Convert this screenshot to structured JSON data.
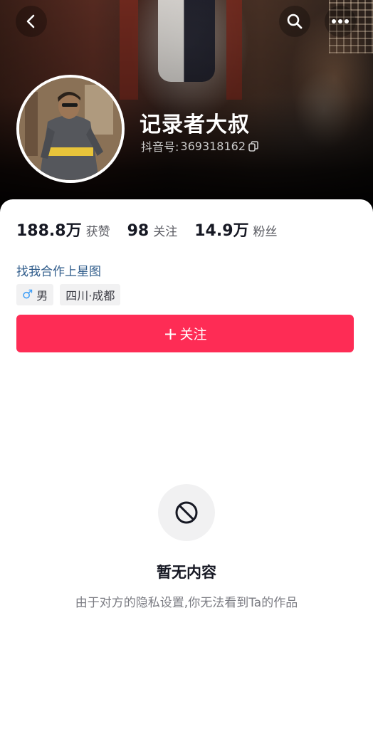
{
  "header": {
    "back_icon": "chevron-left-icon",
    "search_icon": "search-icon",
    "more_icon": "more-dots-icon"
  },
  "profile": {
    "name": "记录者大叔",
    "id_label": "抖音号:",
    "id_value": "369318162",
    "copy_icon": "copy-icon"
  },
  "stats": [
    {
      "value": "188.8万",
      "label": "获赞"
    },
    {
      "value": "98",
      "label": "关注"
    },
    {
      "value": "14.9万",
      "label": "粉丝"
    }
  ],
  "star_link": "找我合作上星图",
  "tags": {
    "gender_symbol": "♂",
    "gender": "男",
    "location": "四川·成都"
  },
  "follow_button": {
    "plus": "+",
    "label": "关注",
    "color": "#fe2c55"
  },
  "empty_state": {
    "icon": "prohibited-icon",
    "title": "暂无内容",
    "description": "由于对方的隐私设置,你无法看到Ta的作品"
  }
}
